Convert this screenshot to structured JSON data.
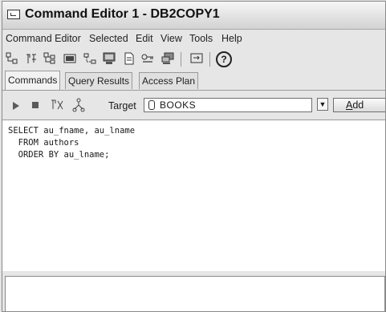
{
  "window": {
    "title": "Command Editor 1 - DB2COPY1"
  },
  "menu": {
    "items": [
      "Command Editor",
      "Selected",
      "Edit",
      "View",
      "Tools",
      "Help"
    ]
  },
  "toolbar": {
    "icons": [
      "connect-icon",
      "disconnect-icon",
      "db-tree-icon",
      "terminal-icon",
      "link-icon",
      "monitor-icon",
      "document-icon",
      "key-icon",
      "workstation-icon",
      "run-icon",
      "help-icon"
    ],
    "help_glyph": "?"
  },
  "tabs": [
    {
      "label": "Commands"
    },
    {
      "label": "Query Results"
    },
    {
      "label": "Access Plan"
    }
  ],
  "command_bar": {
    "target_label": "Target",
    "target_value": "BOOKS",
    "add_label": "Add",
    "add_underline": "A"
  },
  "editor": {
    "lines": [
      "SELECT au_fname, au_lname",
      "  FROM authors",
      "  ORDER BY au_lname;"
    ]
  }
}
